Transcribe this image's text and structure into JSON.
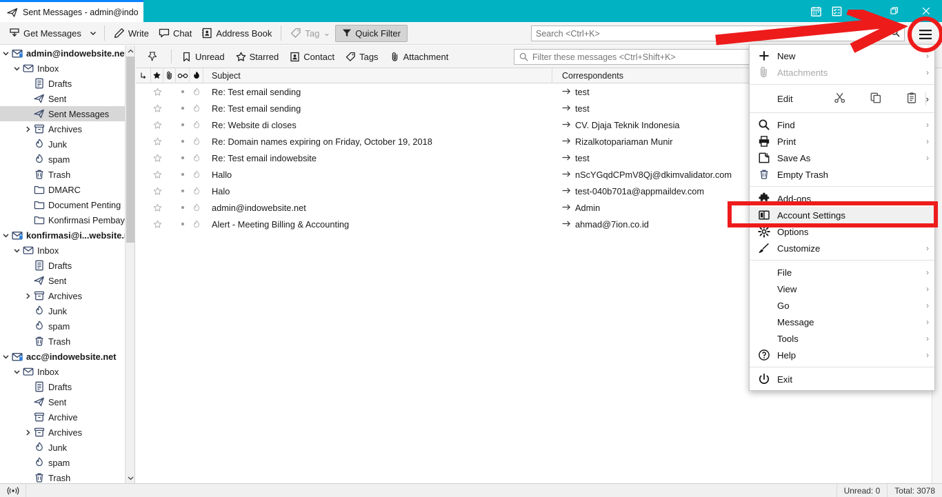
{
  "window": {
    "tab_title": "Sent Messages - admin@indow",
    "tab_icon": "sent-mail-icon",
    "titlebar_color": "#00b2c2",
    "controls": {
      "calendar": "calendar-icon",
      "tasks": "tasks-icon",
      "minimize": "—",
      "restore": "❐",
      "close": "✕"
    }
  },
  "toolbar": {
    "get_messages": "Get Messages",
    "get_messages_caret": "⌄",
    "write": "Write",
    "chat": "Chat",
    "address_book": "Address Book",
    "tag": "Tag",
    "tag_caret": "⌄",
    "quick_filter": "Quick Filter",
    "search_placeholder": "Search <Ctrl+K>"
  },
  "sidebar": {
    "accounts": [
      {
        "name": "admin@indowebsite.net",
        "level": 0,
        "icon": "account-mail-icon",
        "twisty": "down",
        "selected": false
      },
      {
        "name": "Inbox",
        "level": 1,
        "icon": "inbox-icon",
        "twisty": "down",
        "selected": false
      },
      {
        "name": "Drafts",
        "level": 2,
        "icon": "drafts-icon",
        "twisty": "",
        "selected": false
      },
      {
        "name": "Sent",
        "level": 2,
        "icon": "sent-icon",
        "twisty": "",
        "selected": false
      },
      {
        "name": "Sent Messages",
        "level": 2,
        "icon": "sent-icon",
        "twisty": "",
        "selected": true
      },
      {
        "name": "Archives",
        "level": 2,
        "icon": "archive-icon",
        "twisty": "right",
        "selected": false
      },
      {
        "name": "Junk",
        "level": 2,
        "icon": "junk-icon",
        "twisty": "",
        "selected": false
      },
      {
        "name": "spam",
        "level": 2,
        "icon": "junk-icon",
        "twisty": "",
        "selected": false
      },
      {
        "name": "Trash",
        "level": 2,
        "icon": "trash-icon",
        "twisty": "",
        "selected": false
      },
      {
        "name": "DMARC",
        "level": 2,
        "icon": "folder-icon",
        "twisty": "",
        "selected": false
      },
      {
        "name": "Document Penting",
        "level": 2,
        "icon": "folder-icon",
        "twisty": "",
        "selected": false
      },
      {
        "name": "Konfirmasi Pembayaran",
        "level": 2,
        "icon": "folder-icon",
        "twisty": "",
        "selected": false
      },
      {
        "name": "konfirmasi@i...website.net",
        "level": 0,
        "icon": "account-mail-icon",
        "twisty": "down",
        "selected": false
      },
      {
        "name": "Inbox",
        "level": 1,
        "icon": "inbox-icon",
        "twisty": "down",
        "selected": false
      },
      {
        "name": "Drafts",
        "level": 2,
        "icon": "drafts-icon",
        "twisty": "",
        "selected": false
      },
      {
        "name": "Sent",
        "level": 2,
        "icon": "sent-icon",
        "twisty": "",
        "selected": false
      },
      {
        "name": "Archives",
        "level": 2,
        "icon": "archive-icon",
        "twisty": "right",
        "selected": false
      },
      {
        "name": "Junk",
        "level": 2,
        "icon": "junk-icon",
        "twisty": "",
        "selected": false
      },
      {
        "name": "spam",
        "level": 2,
        "icon": "junk-icon",
        "twisty": "",
        "selected": false
      },
      {
        "name": "Trash",
        "level": 2,
        "icon": "trash-icon",
        "twisty": "",
        "selected": false
      },
      {
        "name": "acc@indowebsite.net",
        "level": 0,
        "icon": "account-mail-icon",
        "twisty": "down",
        "selected": false
      },
      {
        "name": "Inbox",
        "level": 1,
        "icon": "inbox-icon",
        "twisty": "down",
        "selected": false
      },
      {
        "name": "Drafts",
        "level": 2,
        "icon": "drafts-icon",
        "twisty": "",
        "selected": false
      },
      {
        "name": "Sent",
        "level": 2,
        "icon": "sent-icon",
        "twisty": "",
        "selected": false
      },
      {
        "name": "Archive",
        "level": 2,
        "icon": "archive-icon",
        "twisty": "",
        "selected": false
      },
      {
        "name": "Archives",
        "level": 2,
        "icon": "archive-icon",
        "twisty": "right",
        "selected": false
      },
      {
        "name": "Junk",
        "level": 2,
        "icon": "junk-icon",
        "twisty": "",
        "selected": false
      },
      {
        "name": "spam",
        "level": 2,
        "icon": "junk-icon",
        "twisty": "",
        "selected": false
      },
      {
        "name": "Trash",
        "level": 2,
        "icon": "trash-icon",
        "twisty": "",
        "selected": false
      }
    ]
  },
  "quickfilter_bar": {
    "pin": "pin-icon",
    "unread": "Unread",
    "starred": "Starred",
    "contact": "Contact",
    "tags": "Tags",
    "attachment": "Attachment",
    "filter_placeholder": "Filter these messages <Ctrl+Shift+K>"
  },
  "message_list": {
    "columns": {
      "thread": "thread-icon",
      "star": "star-icon",
      "attachment": "paperclip-icon",
      "unread": "unread-icon",
      "junk": "junk-icon",
      "subject": "Subject",
      "correspondents": "Correspondents"
    },
    "rows": [
      {
        "subject": "Re: Test email sending",
        "correspondent": "test"
      },
      {
        "subject": "Re: Test email sending",
        "correspondent": "test"
      },
      {
        "subject": "Re: Website di closes",
        "correspondent": "CV. Djaja Teknik Indonesia"
      },
      {
        "subject": "Re: Domain names expiring on Friday, October 19, 2018",
        "correspondent": "Rizalkotopariaman Munir"
      },
      {
        "subject": "Re: Test email indowebsite",
        "correspondent": "test"
      },
      {
        "subject": "Hallo",
        "correspondent": "nScYGqdCPmV8Qj@dkimvalidator.com"
      },
      {
        "subject": "Halo",
        "correspondent": "test-040b701a@appmaildev.com"
      },
      {
        "subject": "admin@indowebsite.net",
        "correspondent": "Admin"
      },
      {
        "subject": "Alert - Meeting Billing & Accounting",
        "correspondent": "ahmad@7ion.co.id"
      }
    ]
  },
  "app_menu": {
    "items": [
      {
        "label": "New",
        "icon": "plus-icon",
        "arrow": "›",
        "disabled": false,
        "highlight": false
      },
      {
        "label": "Attachments",
        "icon": "paperclip-icon",
        "arrow": "›",
        "disabled": true,
        "highlight": false
      },
      {
        "sep": true
      },
      {
        "label": "Edit",
        "edit_row": true,
        "cut": "scissors-icon",
        "copy": "copy-icon",
        "paste": "clipboard-icon",
        "arrow": "›"
      },
      {
        "sep": true
      },
      {
        "label": "Find",
        "icon": "magnifier-icon",
        "arrow": "›",
        "disabled": false,
        "highlight": false
      },
      {
        "label": "Print",
        "icon": "printer-icon",
        "arrow": "›",
        "disabled": false,
        "highlight": false
      },
      {
        "label": "Save As",
        "icon": "save-as-icon",
        "arrow": "›",
        "disabled": false,
        "highlight": false
      },
      {
        "label": "Empty Trash",
        "icon": "trash-icon",
        "arrow": "",
        "disabled": false,
        "highlight": false
      },
      {
        "sep": true
      },
      {
        "label": "Add-ons",
        "icon": "puzzle-icon",
        "arrow": "",
        "disabled": false,
        "highlight": false
      },
      {
        "label": "Account Settings",
        "icon": "account-settings-icon",
        "arrow": "",
        "disabled": false,
        "highlight": true
      },
      {
        "label": "Options",
        "icon": "gear-icon",
        "arrow": "",
        "disabled": false,
        "highlight": false
      },
      {
        "label": "Customize",
        "icon": "brush-icon",
        "arrow": "›",
        "disabled": false,
        "highlight": false
      },
      {
        "sep": true
      },
      {
        "label": "File",
        "icon": "",
        "arrow": "›",
        "disabled": false,
        "highlight": false
      },
      {
        "label": "View",
        "icon": "",
        "arrow": "›",
        "disabled": false,
        "highlight": false
      },
      {
        "label": "Go",
        "icon": "",
        "arrow": "›",
        "disabled": false,
        "highlight": false
      },
      {
        "label": "Message",
        "icon": "",
        "arrow": "›",
        "disabled": false,
        "highlight": false
      },
      {
        "label": "Tools",
        "icon": "",
        "arrow": "›",
        "disabled": false,
        "highlight": false
      },
      {
        "label": "Help",
        "icon": "help-icon",
        "arrow": "›",
        "disabled": false,
        "highlight": false
      },
      {
        "sep": true
      },
      {
        "label": "Exit",
        "icon": "power-icon",
        "arrow": "",
        "disabled": false,
        "highlight": false
      }
    ]
  },
  "statusbar": {
    "connection_icon": "offline-icon",
    "unread": "Unread: 0",
    "total": "Total: 3078"
  },
  "annotations": {
    "color": "#ee1b1b",
    "arrow": "arrow-pointing-to-app-menu",
    "circle": "circle-around-app-menu-button",
    "rect": "rectangle-around-account-settings"
  }
}
